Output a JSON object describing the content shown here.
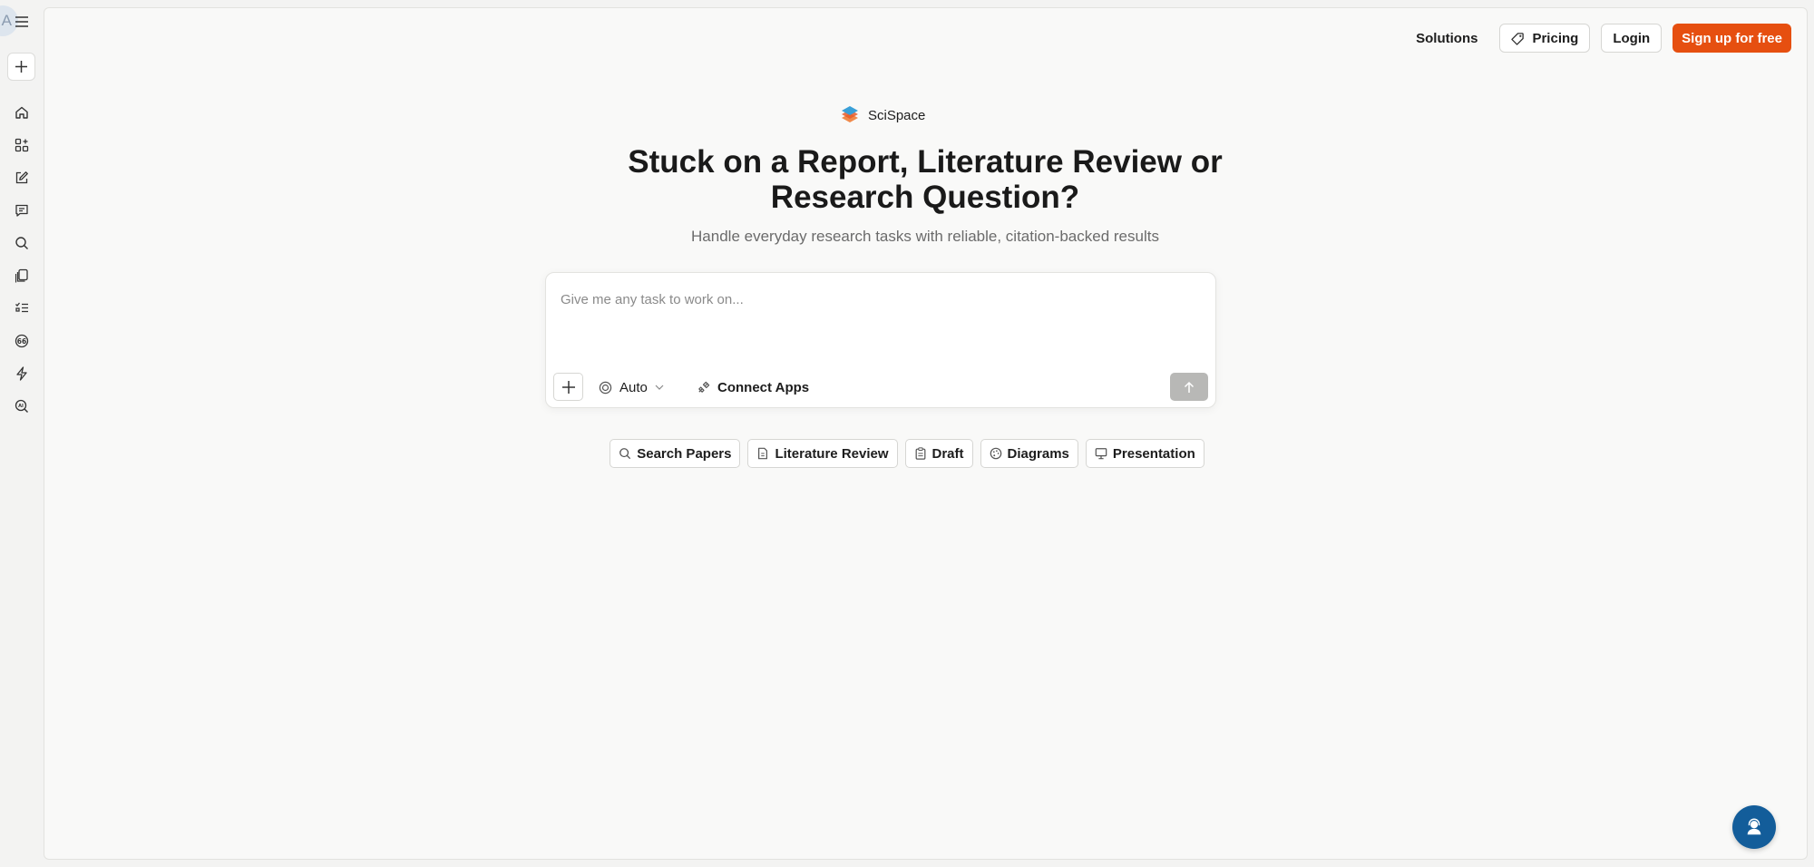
{
  "sidebar": {
    "avatar_letter": "A",
    "menu_icon": "hamburger-menu-icon",
    "new_icon": "plus-icon",
    "items": [
      {
        "icon": "home-icon"
      },
      {
        "icon": "apps-grid-icon"
      },
      {
        "icon": "edit-icon"
      },
      {
        "icon": "chat-icon"
      },
      {
        "icon": "search-icon"
      },
      {
        "icon": "library-icon"
      },
      {
        "icon": "checklist-icon"
      },
      {
        "icon": "citation-icon"
      },
      {
        "icon": "bolt-icon"
      },
      {
        "icon": "ai-detector-icon"
      }
    ]
  },
  "topnav": {
    "solutions": "Solutions",
    "pricing": "Pricing",
    "login": "Login",
    "signup": "Sign up for free"
  },
  "brand": {
    "name": "SciSpace"
  },
  "hero": {
    "title_line1": "Stuck on a Report, Literature Review or",
    "title_line2": "Research Question?",
    "subtitle": "Handle everyday research tasks with reliable, citation-backed results"
  },
  "composer": {
    "placeholder": "Give me any task to work on...",
    "value": "",
    "mode": "Auto",
    "connect_apps": "Connect Apps"
  },
  "chips": [
    {
      "label": "Search Papers",
      "icon": "search-icon"
    },
    {
      "label": "Literature Review",
      "icon": "document-icon"
    },
    {
      "label": "Draft",
      "icon": "clipboard-icon"
    },
    {
      "label": "Diagrams",
      "icon": "palette-icon"
    },
    {
      "label": "Presentation",
      "icon": "monitor-icon"
    }
  ],
  "colors": {
    "accent": "#e64f10",
    "help_fab": "#135d9a"
  }
}
